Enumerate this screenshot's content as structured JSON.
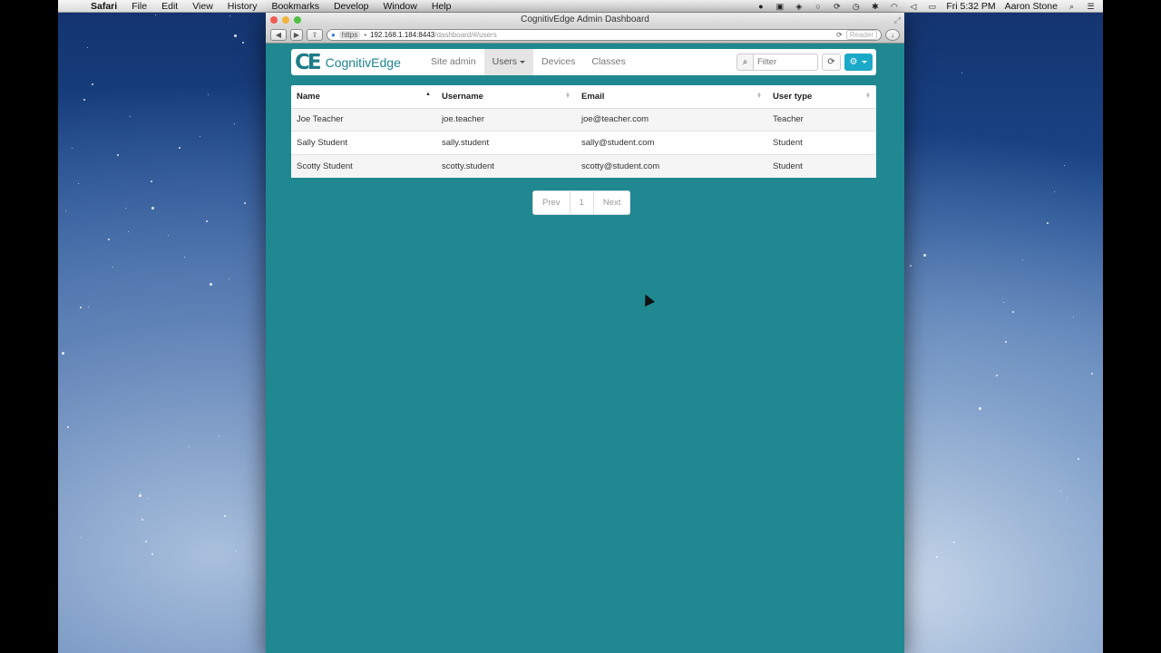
{
  "menubar": {
    "app": "Safari",
    "items": [
      "File",
      "Edit",
      "View",
      "History",
      "Bookmarks",
      "Develop",
      "Window",
      "Help"
    ],
    "clock": "Fri 5:32 PM",
    "user": "Aaron Stone"
  },
  "browser": {
    "title": "CognitivEdge Admin Dashboard",
    "url_scheme": "https",
    "url_host": "192.168.1.184:8443",
    "url_path": "/dashboard/#/users",
    "reader_label": "Reader"
  },
  "nav": {
    "brand_mark": "CE",
    "brand_name": "CognitivEdge",
    "items": [
      {
        "label": "Site admin"
      },
      {
        "label": "Users",
        "active": true
      },
      {
        "label": "Devices"
      },
      {
        "label": "Classes"
      }
    ],
    "filter_placeholder": "Filter"
  },
  "table": {
    "columns": [
      "Name",
      "Username",
      "Email",
      "User type"
    ],
    "rows": [
      [
        "Joe Teacher",
        "joe.teacher",
        "joe@teacher.com",
        "Teacher"
      ],
      [
        "Sally Student",
        "sally.student",
        "sally@student.com",
        "Student"
      ],
      [
        "Scotty Student",
        "scotty.student",
        "scotty@student.com",
        "Student"
      ]
    ]
  },
  "pager": {
    "prev": "Prev",
    "page": "1",
    "next": "Next"
  },
  "colors": {
    "page_bg": "#1f8890",
    "accent": "#1ba9c8",
    "brand": "#1d7c88"
  }
}
